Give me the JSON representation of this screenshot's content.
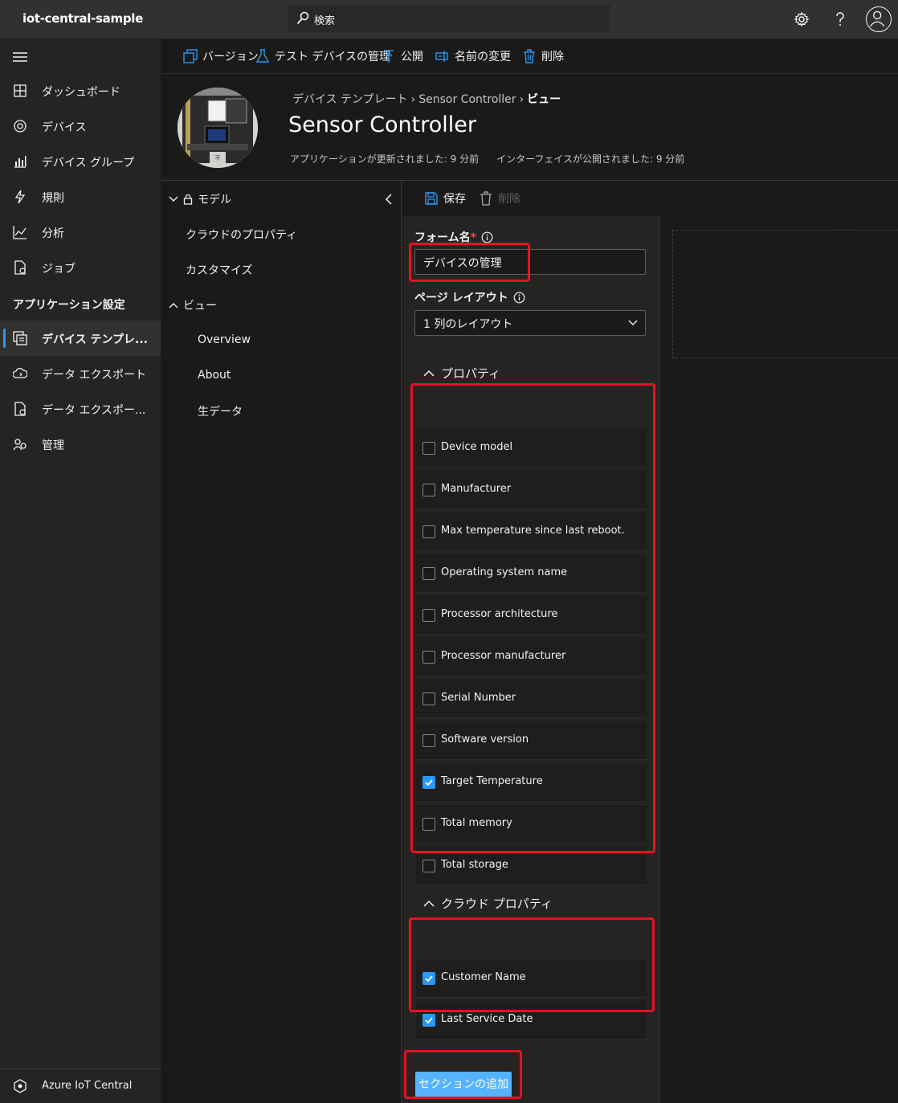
{
  "topbar": {
    "app_title": "iot-central-sample",
    "search_placeholder": "検索",
    "icons": [
      "gear-icon",
      "help-icon",
      "avatar-icon"
    ]
  },
  "leftnav": {
    "items": [
      {
        "label": "ダッシュボード",
        "icon": "dashboard-icon"
      },
      {
        "label": "デバイス",
        "icon": "devices-icon"
      },
      {
        "label": "デバイス グループ",
        "icon": "device-groups-icon"
      },
      {
        "label": "規則",
        "icon": "rules-icon"
      },
      {
        "label": "分析",
        "icon": "analytics-icon"
      },
      {
        "label": "ジョブ",
        "icon": "jobs-icon"
      }
    ],
    "section_title": "アプリケーション設定",
    "settings_items": [
      {
        "label": "デバイス テンプレ...",
        "icon": "device-templates-icon",
        "selected": true
      },
      {
        "label": "データ エクスポート",
        "icon": "data-export-icon"
      },
      {
        "label": "データ エクスポー...",
        "icon": "data-export-legacy-icon"
      },
      {
        "label": "管理",
        "icon": "admin-icon"
      }
    ],
    "brand_label": "Azure IoT Central"
  },
  "commandbar": {
    "version": "バージョン",
    "test_devices": "テスト デバイスの管理",
    "publish": "公開",
    "rename": "名前の変更",
    "delete": "削除"
  },
  "header": {
    "breadcrumb": [
      "デバイス テンプレート",
      "Sensor Controller",
      "ビュー"
    ],
    "title": "Sensor Controller",
    "app_updated": "アプリケーションが更新されました: 9 分前",
    "interface_published": "インターフェイスが公開されました: 9 分前"
  },
  "tree": {
    "model": "モデル",
    "cloud_properties": "クラウドのプロパティ",
    "customize": "カスタマイズ",
    "views": "ビュー",
    "view_items": [
      "Overview",
      "About",
      "生データ"
    ]
  },
  "form": {
    "save": "保存",
    "delete": "削除",
    "form_name_label": "フォーム名",
    "required_mark": "*",
    "form_name_value": "デバイスの管理",
    "layout_label": "ページ レイアウト",
    "layout_value": "1 列のレイアウト",
    "properties_title": "プロパティ",
    "properties": [
      {
        "label": "Device model",
        "checked": false
      },
      {
        "label": "Manufacturer",
        "checked": false
      },
      {
        "label": "Max temperature since last reboot.",
        "checked": false
      },
      {
        "label": "Operating system name",
        "checked": false
      },
      {
        "label": "Processor architecture",
        "checked": false
      },
      {
        "label": "Processor manufacturer",
        "checked": false
      },
      {
        "label": "Serial Number",
        "checked": false
      },
      {
        "label": "Software version",
        "checked": false
      },
      {
        "label": "Target Temperature",
        "checked": true
      },
      {
        "label": "Total memory",
        "checked": false
      },
      {
        "label": "Total storage",
        "checked": false
      }
    ],
    "cloud_properties_title": "クラウド プロパティ",
    "cloud_properties": [
      {
        "label": "Customer Name",
        "checked": true
      },
      {
        "label": "Last Service Date",
        "checked": true
      }
    ],
    "add_section": "セクションの追加"
  },
  "colors": {
    "accent": "#2899f5",
    "button": "#55b3ff",
    "annotation": "#e81123",
    "required": "#ff4343"
  }
}
